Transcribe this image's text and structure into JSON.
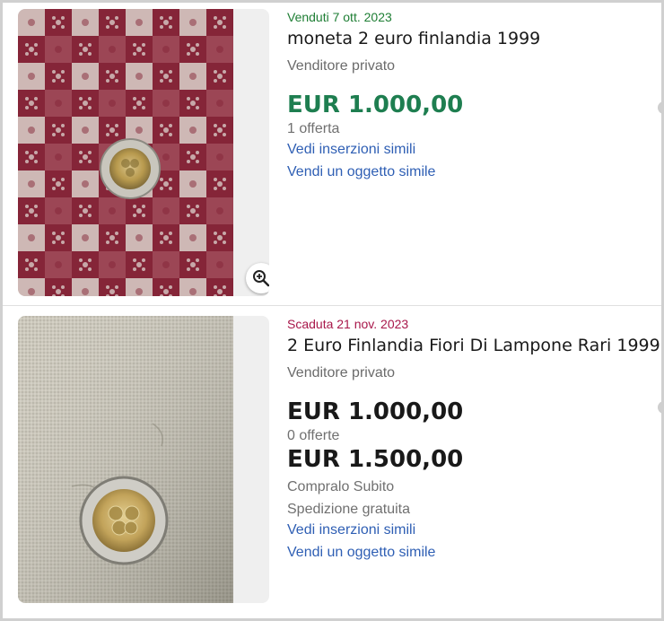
{
  "listings": [
    {
      "status": "Venduti 7 ott. 2023",
      "title": "moneta 2 euro finlandia 1999",
      "seller": "Venditore privato",
      "price": "EUR 1.000,00",
      "offers": "1 offerta",
      "link_similar": "Vedi inserzioni simili",
      "link_sell": "Vendi un oggetto simile",
      "image": "coin-on-red-patterned-cloth"
    },
    {
      "status": "Scaduta 21 nov. 2023",
      "title": "2 Euro Finlandia Fiori Di Lampone Rari 1999",
      "seller": "Venditore privato",
      "price": "EUR 1.000,00",
      "offers": "0 offerte",
      "buy_now_price": "EUR 1.500,00",
      "buy_now_label": "Compralo Subito",
      "shipping": "Spedizione gratuita",
      "link_similar": "Vedi inserzioni simili",
      "link_sell": "Vendi un oggetto simile",
      "image": "coin-on-beige-fabric"
    }
  ],
  "colors": {
    "sold_status": "#1e7e34",
    "expired_status": "#a8174a",
    "sold_price": "#1e7e50",
    "link": "#2f5fb4"
  },
  "icons": {
    "zoom": "zoom-in-icon"
  }
}
